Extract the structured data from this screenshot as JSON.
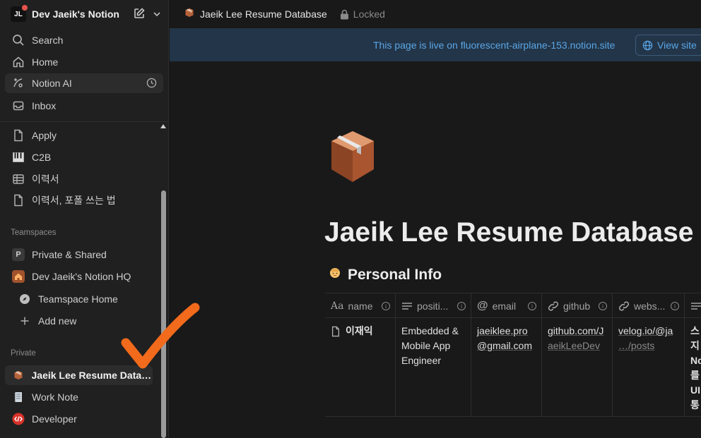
{
  "sidebar": {
    "workspace": {
      "logo_text": "JL",
      "name": "Dev Jaeik's Notion"
    },
    "top_items": [
      {
        "label": "Search",
        "icon": "search-icon"
      },
      {
        "label": "Home",
        "icon": "home-icon"
      },
      {
        "label": "Notion AI",
        "icon": "notion-ai-icon"
      },
      {
        "label": "Inbox",
        "icon": "inbox-icon"
      }
    ],
    "pages": [
      {
        "label": "Apply",
        "icon": "document-icon"
      },
      {
        "label": "C2B",
        "icon": "piano-icon"
      },
      {
        "label": "이력서",
        "icon": "table-icon"
      },
      {
        "label": "이력서, 포폴 쓰는 법",
        "icon": "document-icon"
      }
    ],
    "teamspaces_label": "Teamspaces",
    "teamspaces": [
      {
        "label": "Private & Shared",
        "badge": "P"
      },
      {
        "label": "Dev Jaeik's Notion HQ",
        "icon": "house-icon"
      },
      {
        "label": "Teamspace Home",
        "icon": "compass-icon"
      },
      {
        "label": "Add new",
        "icon": "plus-icon"
      }
    ],
    "private_label": "Private",
    "private": [
      {
        "label": "Jaeik Lee Resume Datab...",
        "icon": "package-icon"
      },
      {
        "label": "Work Note",
        "icon": "notebook-icon"
      },
      {
        "label": "Developer",
        "icon": "code-icon"
      }
    ]
  },
  "topbar": {
    "breadcrumb_title": "Jaeik Lee Resume Database",
    "lock_label": "Locked"
  },
  "banner": {
    "text": "This page is live on fluorescent-airplane-153.notion.site",
    "view_site_label": "View site"
  },
  "page": {
    "title": "Jaeik Lee Resume Database",
    "section_title": "Personal Info",
    "table": {
      "columns": [
        {
          "label": "name",
          "icon": "title-icon"
        },
        {
          "label": "positi...",
          "icon": "text-icon"
        },
        {
          "label": "email",
          "icon": "at-icon"
        },
        {
          "label": "github",
          "icon": "link-icon"
        },
        {
          "label": "webs...",
          "icon": "link-icon"
        }
      ],
      "rows": [
        {
          "name": "이재익",
          "position_lines": [
            "Embedded &",
            "Mobile App",
            "Engineer"
          ],
          "email_lines": [
            "jaeiklee.pro",
            "@gmail.com"
          ],
          "github_lines": [
            "github.com/J",
            "aeikLeeDev"
          ],
          "website_lines": [
            "velog.io/@ja",
            "…/posts"
          ],
          "extra_lines": [
            "스",
            "지",
            "No",
            "를",
            "UI",
            "통"
          ]
        }
      ]
    }
  },
  "colors": {
    "sidebar_bg": "#202020",
    "page_bg": "#191919",
    "banner_bg": "#233548",
    "banner_text": "#5aa6e6",
    "annotation": "#f26a1b"
  }
}
